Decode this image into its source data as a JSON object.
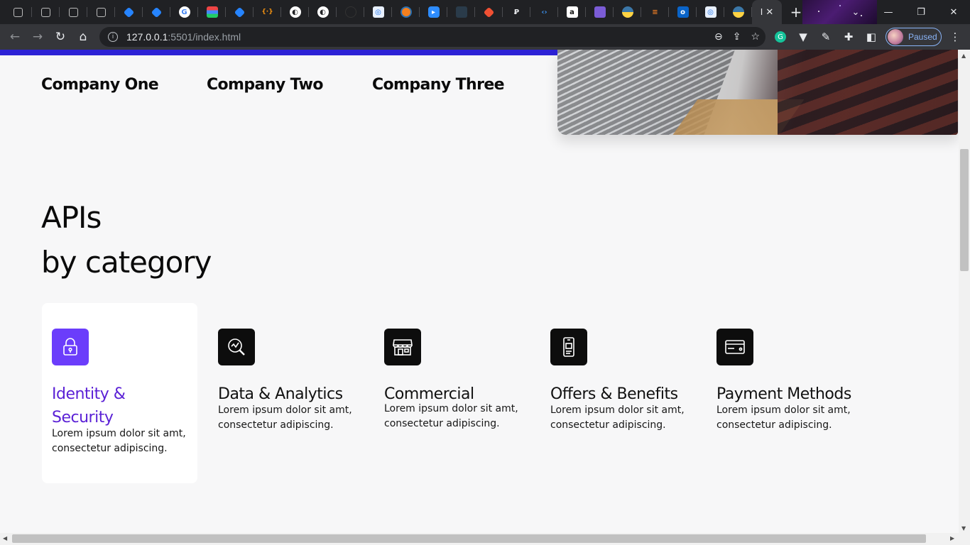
{
  "browser": {
    "tab_icons": [
      "square-icon",
      "square-icon",
      "square-icon",
      "square-icon",
      "jira-icon",
      "jira-icon",
      "google-icon",
      "stack-icon",
      "jira-icon",
      "json-icon",
      "globe-icon",
      "globe-icon",
      "github-icon",
      "camera-icon",
      "orange-circle-icon",
      "zoom-icon",
      "page-icon",
      "git-icon",
      "p-icon",
      "code-icon",
      "amazon-icon",
      "purple-icon",
      "python-icon",
      "stackoverflow-icon",
      "outlook-icon",
      "camera-icon",
      "python-icon"
    ],
    "active_tab_label": "I",
    "url_host": "127.0.0.1",
    "url_rest": ":5501/index.html",
    "profile_status": "Paused",
    "accent": "#8ab4f8"
  },
  "page": {
    "companies": [
      "Company One",
      "Company Two",
      "Company Three"
    ],
    "heading_line1": "APIs",
    "heading_line2": "by category",
    "accent_color": "#6b3dfb",
    "cards": [
      {
        "title": "Identity & Security",
        "desc": "Lorem ipsum dolor sit amt, consectetur adipiscing.",
        "icon": "lock-icon",
        "active": true
      },
      {
        "title": "Data & Analytics",
        "desc": "Lorem ipsum dolor sit amt, consectetur adipiscing.",
        "icon": "analytics-search-icon",
        "active": false
      },
      {
        "title": "Commercial",
        "desc": "Lorem ipsum dolor sit amt, consectetur adipiscing.",
        "icon": "store-icon",
        "active": false
      },
      {
        "title": "Offers & Benefits",
        "desc": "Lorem ipsum dolor sit amt, consectetur adipiscing.",
        "icon": "mobile-offer-icon",
        "active": false
      },
      {
        "title": "Payment Methods",
        "desc": "Lorem ipsum dolor sit amt, consectetur adipiscing.",
        "icon": "credit-card-icon",
        "active": false
      }
    ]
  }
}
